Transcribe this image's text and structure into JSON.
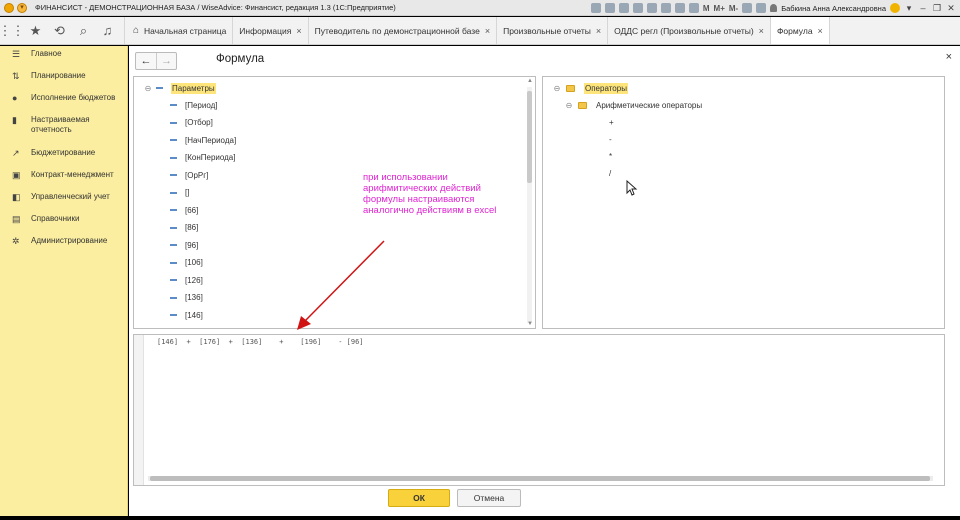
{
  "titlebar": {
    "title": "ФИНАНСИСТ - ДЕМОНСТРАЦИОННАЯ БАЗА / WiseAdvice: Финансист, редакция 1.3  (1С:Предприятие)",
    "m_labels": [
      "M",
      "M+",
      "M-"
    ],
    "user": "Бабкина Анна Александровна"
  },
  "tabs": [
    {
      "label": "Начальная страница",
      "closable": false,
      "icon": "home-icon"
    },
    {
      "label": "Информация",
      "closable": true
    },
    {
      "label": "Путеводитель по демонстрационной базе",
      "closable": true
    },
    {
      "label": "Произвольные отчеты",
      "closable": true
    },
    {
      "label": "ОДДС регл (Произвольные отчеты)",
      "closable": true
    },
    {
      "label": "Формула",
      "closable": true,
      "active": true
    }
  ],
  "sidebar": {
    "items": [
      {
        "label": "Главное",
        "icon": "menu-icon"
      },
      {
        "label": "Планирование",
        "icon": "planning-icon"
      },
      {
        "label": "Исполнение бюджетов",
        "icon": "budget-icon"
      },
      {
        "label": "Настраиваемая отчетность",
        "icon": "chart-icon"
      },
      {
        "label": "Бюджетирование",
        "icon": "trend-icon"
      },
      {
        "label": "Контракт-менеджмент",
        "icon": "contract-icon"
      },
      {
        "label": "Управленческий учет",
        "icon": "accounting-icon"
      },
      {
        "label": "Справочники",
        "icon": "book-icon"
      },
      {
        "label": "Администрирование",
        "icon": "gear-icon"
      }
    ]
  },
  "form": {
    "title": "Формула",
    "close": "×",
    "back": "←",
    "forward": "→"
  },
  "params_tree": {
    "root": "Параметры",
    "items": [
      "[Период]",
      "[Отбор]",
      "[НачПериода]",
      "[КонПериода]",
      "[ОрРг]",
      "[]",
      "[66]",
      "[86]",
      "[96]",
      "[106]",
      "[126]",
      "[136]",
      "[146]"
    ]
  },
  "operators_tree": {
    "root": "Операторы",
    "group": "Арифметические операторы",
    "items": [
      "+",
      "-",
      "*",
      "/"
    ]
  },
  "annotation": "при использовании арифмитических действий формулы настраиваются аналогично действиям в excel",
  "formula": "[146]  +  [176]  +  [136]    +    [196]    - [96]",
  "buttons": {
    "ok": "ОК",
    "cancel": "Отмена"
  },
  "colors": {
    "sidebar_bg": "#fbeea0",
    "highlight": "#fde57c",
    "ok_button": "#f9d23b",
    "annotation": "#e024d2",
    "arrow": "#d01414"
  }
}
